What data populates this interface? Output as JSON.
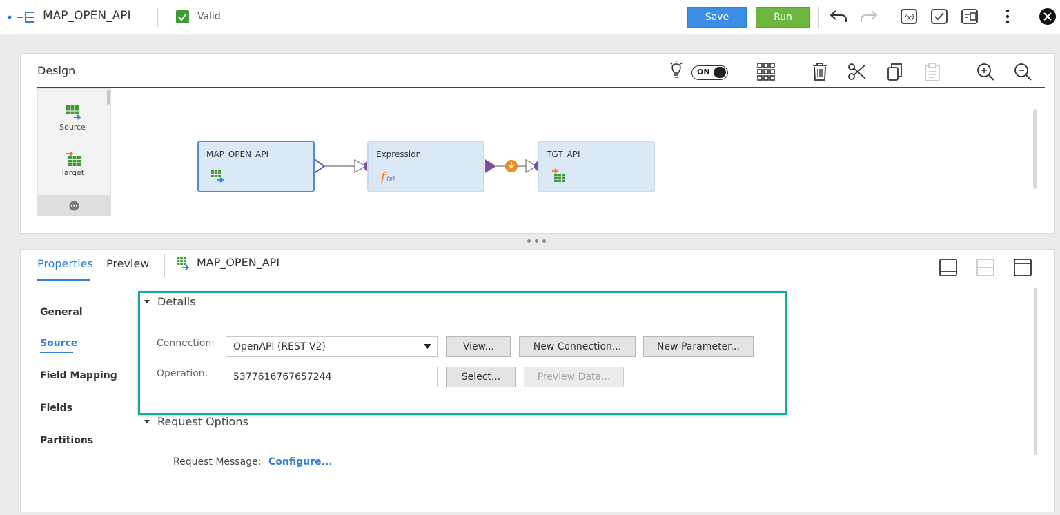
{
  "topbar": {
    "title": "MAP_OPEN_API",
    "status": "Valid",
    "save_label": "Save",
    "run_label": "Run"
  },
  "design": {
    "title": "Design",
    "toggle_label": "ON",
    "palette": [
      {
        "label": "Source"
      },
      {
        "label": "Target"
      }
    ],
    "nodes": [
      {
        "label": "MAP_OPEN_API"
      },
      {
        "label": "Expression"
      },
      {
        "label": "TGT_API"
      }
    ]
  },
  "props": {
    "tabs": {
      "properties": "Properties",
      "preview": "Preview",
      "object": "MAP_OPEN_API"
    },
    "sidebar": [
      {
        "label": "General"
      },
      {
        "label": "Source"
      },
      {
        "label": "Field Mapping"
      },
      {
        "label": "Fields"
      },
      {
        "label": "Partitions"
      }
    ],
    "details": {
      "title": "Details",
      "connection_label": "Connection:",
      "connection_value": "OpenAPI (REST V2)",
      "view_btn": "View...",
      "new_connection_btn": "New Connection...",
      "new_parameter_btn": "New Parameter...",
      "operation_label": "Operation:",
      "operation_value": "5377616767657244",
      "select_btn": "Select...",
      "preview_data_btn": "Preview Data..."
    },
    "request_options": {
      "title": "Request Options",
      "request_message_label": "Request Message:",
      "configure_link": "Configure..."
    }
  },
  "colors": {
    "accent": "#2f7fd4",
    "save": "#3a8ee6",
    "run": "#6db63f",
    "valid": "#3d9a36",
    "highlight": "#1aa9a1"
  }
}
